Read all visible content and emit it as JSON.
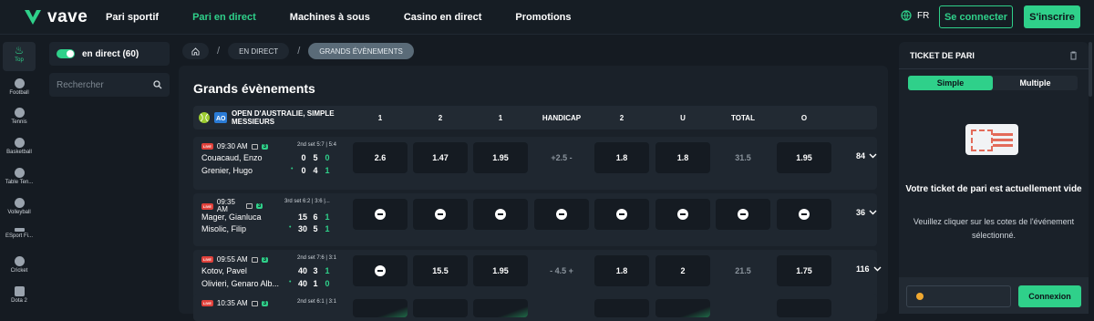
{
  "header": {
    "logo_text": "vave",
    "nav": [
      "Pari sportif",
      "Pari en direct",
      "Machines à sous",
      "Casino en direct",
      "Promotions"
    ],
    "active_nav": "Pari en direct",
    "lang": "FR",
    "login_label": "Se connecter",
    "signup_label": "S'inscrire",
    "accent_color": "#2fd08a"
  },
  "sports": [
    "Top",
    "Football",
    "Tennis",
    "Basketball",
    "Table Ten...",
    "Volleyball",
    "ESport Fi...",
    "Cricket",
    "Dota 2"
  ],
  "left_panel": {
    "live_label": "en direct (60)",
    "search_placeholder": "Rechercher"
  },
  "breadcrumb": [
    "EN DIRECT",
    "GRANDS ÉVÈNEMENTS"
  ],
  "main": {
    "title": "Grands évènements",
    "tournament": "OPEN D'AUSTRALIE, SIMPLE MESSIEURS",
    "columns": [
      "1",
      "2",
      "1",
      "HANDICAP",
      "2",
      "U",
      "TOTAL",
      "O"
    ],
    "matches": [
      {
        "time": "09:30 AM",
        "count": "3",
        "set": "2nd set 5:7 | 5:4",
        "p1": "Couacaud, Enzo",
        "p2": "Grenier, Hugo",
        "s1": [
          "0",
          "5",
          "0"
        ],
        "s2": [
          "0",
          "4",
          "1"
        ],
        "odds": [
          "2.6",
          "1.47",
          "1.95",
          "+2.5 -",
          "1.8",
          "1.8",
          "31.5",
          "1.95"
        ],
        "more": "84"
      },
      {
        "time": "09:35 AM",
        "count": "3",
        "set": "3rd set 6:2 | 3:6 |...",
        "p1": "Mager, Gianluca",
        "p2": "Misolic, Filip",
        "s1": [
          "15",
          "6",
          "1"
        ],
        "s2": [
          "30",
          "5",
          "1"
        ],
        "odds": [
          "lock",
          "lock",
          "lock",
          "lock",
          "lock",
          "lock",
          "lock",
          "lock"
        ],
        "more": "36"
      },
      {
        "time": "09:55 AM",
        "count": "3",
        "set": "2nd set 7:6 | 3:1",
        "p1": "Kotov, Pavel",
        "p2": "Olivieri, Genaro Alb...",
        "s1": [
          "40",
          "3",
          "1"
        ],
        "s2": [
          "40",
          "1",
          "0"
        ],
        "odds": [
          "lock",
          "15.5",
          "1.95",
          "- 4.5 +",
          "1.8",
          "2",
          "21.5",
          "1.75"
        ],
        "more": "116"
      },
      {
        "time": "10:35 AM",
        "count": "3",
        "set": "2nd set 6:1 | 3:1"
      }
    ]
  },
  "ticket": {
    "title": "TICKET DE PARI",
    "tabs": [
      "Simple",
      "Multiple"
    ],
    "empty_title": "Votre ticket de pari est actuellement vide",
    "empty_sub": "Veuillez cliquer sur les cotes de l'événement sélectionné.",
    "button": "Connexion"
  }
}
